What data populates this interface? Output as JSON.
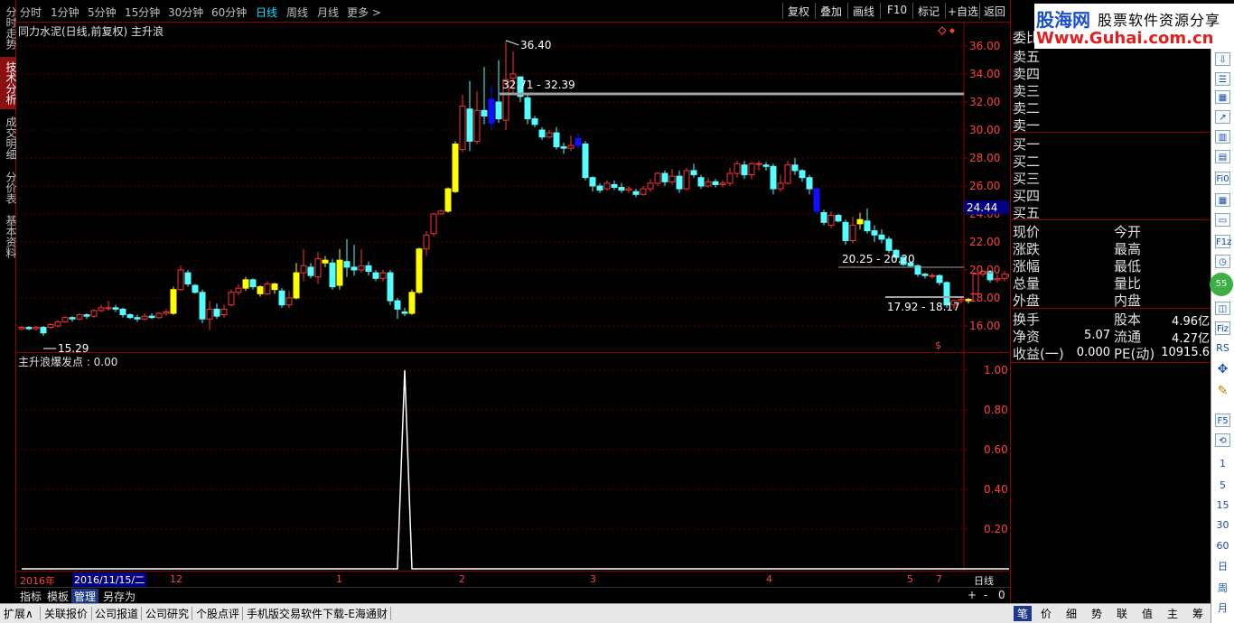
{
  "toolbar": {
    "periods": [
      "分时",
      "1分钟",
      "5分钟",
      "15分钟",
      "30分钟",
      "60分钟",
      "日线",
      "周线",
      "月线",
      "更多 >"
    ],
    "active_period": "日线",
    "buttons": [
      "复权",
      "叠加",
      "画线",
      "F10",
      "标记",
      "+自选",
      "返回"
    ]
  },
  "left_tabs": [
    "分时走势",
    "技术分析",
    "成交明细",
    "分价表",
    "基本资料"
  ],
  "main_chart": {
    "title": "同力水泥(日线,前复权) 主升浪",
    "price_axis": [
      "36.00",
      "34.00",
      "32.00",
      "30.00",
      "28.00",
      "26.00",
      "24.00",
      "22.00",
      "20.00",
      "18.00",
      "16.00"
    ],
    "current_price_tag": "24.44",
    "annotations": {
      "high": "36.40",
      "low": "15.29",
      "range1": "32.71 - 32.39",
      "range2": "20.25 - 20.20",
      "range3": "17.92 - 18.17"
    }
  },
  "sub_chart": {
    "title": "主升浪爆发点 : 0.00",
    "axis": [
      "1.00",
      "0.80",
      "0.60",
      "0.40",
      "0.20"
    ]
  },
  "chart_data": {
    "type": "candlestick",
    "ylim": [
      15,
      37
    ],
    "candles": [
      [
        15.8,
        15.9,
        15.7,
        16.0
      ],
      [
        15.9,
        15.8,
        15.7,
        16.0
      ],
      [
        15.8,
        15.9,
        15.7,
        16.0
      ],
      [
        15.9,
        15.5,
        15.29,
        16.0
      ],
      [
        15.9,
        16.1,
        15.8,
        16.2
      ],
      [
        16.0,
        16.3,
        15.9,
        16.4
      ],
      [
        16.3,
        16.6,
        16.2,
        16.7
      ],
      [
        16.6,
        16.5,
        16.3,
        16.7
      ],
      [
        16.5,
        16.8,
        16.4,
        16.9
      ],
      [
        16.8,
        16.7,
        16.5,
        16.9
      ],
      [
        16.7,
        17.1,
        16.6,
        17.2
      ],
      [
        17.1,
        17.3,
        17.0,
        17.5
      ],
      [
        17.3,
        17.3,
        17.1,
        17.8
      ],
      [
        17.3,
        17.2,
        17.0,
        17.5
      ],
      [
        17.2,
        16.8,
        16.6,
        17.3
      ],
      [
        16.8,
        16.6,
        16.5,
        16.9
      ],
      [
        16.6,
        16.5,
        16.3,
        16.8
      ],
      [
        16.5,
        16.7,
        16.4,
        16.9
      ],
      [
        16.7,
        16.6,
        16.5,
        16.9
      ],
      [
        16.6,
        16.9,
        16.5,
        17.0
      ],
      [
        16.9,
        17.0,
        16.7,
        17.2
      ],
      [
        16.9,
        18.6,
        16.8,
        18.8
      ],
      [
        18.6,
        20.0,
        18.5,
        20.3
      ],
      [
        19.8,
        19.0,
        18.8,
        20.0
      ],
      [
        18.9,
        18.4,
        18.3,
        19.0
      ],
      [
        18.4,
        16.5,
        16.2,
        18.6
      ],
      [
        16.5,
        17.2,
        15.7,
        17.8
      ],
      [
        17.2,
        16.7,
        16.5,
        17.6
      ],
      [
        16.8,
        17.2,
        16.6,
        17.5
      ],
      [
        17.5,
        18.4,
        17.4,
        18.6
      ],
      [
        18.4,
        18.7,
        18.2,
        19.0
      ],
      [
        18.7,
        19.3,
        18.5,
        19.5
      ],
      [
        19.3,
        18.8,
        18.6,
        19.4
      ],
      [
        18.8,
        18.3,
        18.1,
        18.9
      ],
      [
        18.3,
        19.0,
        18.2,
        19.2
      ],
      [
        19.0,
        18.6,
        18.3,
        19.1
      ],
      [
        18.5,
        17.5,
        17.3,
        18.7
      ],
      [
        17.5,
        18.0,
        17.3,
        18.5
      ],
      [
        18.0,
        19.8,
        17.9,
        20.5
      ],
      [
        19.8,
        20.3,
        19.2,
        21.5
      ],
      [
        20.2,
        19.6,
        19.4,
        20.5
      ],
      [
        19.5,
        20.8,
        19.0,
        21.3
      ],
      [
        20.7,
        20.5,
        20.2,
        21.0
      ],
      [
        20.5,
        18.8,
        18.6,
        20.8
      ],
      [
        18.9,
        20.7,
        18.6,
        21.5
      ],
      [
        20.6,
        20.2,
        19.5,
        22.2
      ],
      [
        20.2,
        20.0,
        19.6,
        21.8
      ],
      [
        20.0,
        20.3,
        19.8,
        21.5
      ],
      [
        20.3,
        19.9,
        19.6,
        20.6
      ],
      [
        19.8,
        19.4,
        19.2,
        20.0
      ],
      [
        19.4,
        19.8,
        19.2,
        20.0
      ],
      [
        19.8,
        17.8,
        17.5,
        20.0
      ],
      [
        17.8,
        17.2,
        16.5,
        18.0
      ],
      [
        17.0,
        16.9,
        16.7,
        17.3
      ],
      [
        16.9,
        18.4,
        16.8,
        18.6
      ],
      [
        18.4,
        21.5,
        18.3,
        21.6
      ],
      [
        21.5,
        22.5,
        21.0,
        22.8
      ],
      [
        22.6,
        24.0,
        22.4,
        24.1
      ],
      [
        24.0,
        24.2,
        24.0,
        24.3
      ],
      [
        24.2,
        25.8,
        24.1,
        25.9
      ],
      [
        25.6,
        29.0,
        25.5,
        29.2
      ],
      [
        28.6,
        31.7,
        28.4,
        32.5
      ],
      [
        31.5,
        29.2,
        28.5,
        33.5
      ],
      [
        29.2,
        31.4,
        29.0,
        32.8
      ],
      [
        31.4,
        31.0,
        30.4,
        34.5
      ],
      [
        30.5,
        32.2,
        30.0,
        33.2
      ],
      [
        32.0,
        30.8,
        30.5,
        35.0
      ],
      [
        30.7,
        33.6,
        30.0,
        36.4
      ],
      [
        33.7,
        34.0,
        32.6,
        35.6
      ],
      [
        33.8,
        32.4,
        32.0,
        33.8
      ],
      [
        32.3,
        30.8,
        30.4,
        32.6
      ],
      [
        30.8,
        30.4,
        30.2,
        31.0
      ],
      [
        30.0,
        29.5,
        29.3,
        30.2
      ],
      [
        29.5,
        29.8,
        29.4,
        30.0
      ],
      [
        29.8,
        28.8,
        28.6,
        30.2
      ],
      [
        28.8,
        28.7,
        28.3,
        29.1
      ],
      [
        28.7,
        28.9,
        28.5,
        29.6
      ],
      [
        28.9,
        29.4,
        28.7,
        29.8
      ],
      [
        29.0,
        26.6,
        26.4,
        29.2
      ],
      [
        26.6,
        26.0,
        25.6,
        26.7
      ],
      [
        26.0,
        25.7,
        25.5,
        26.2
      ],
      [
        25.8,
        26.2,
        25.7,
        26.4
      ],
      [
        26.1,
        25.9,
        25.7,
        26.4
      ],
      [
        25.9,
        25.7,
        25.5,
        26.2
      ],
      [
        25.7,
        25.8,
        25.5,
        26.0
      ],
      [
        25.6,
        25.4,
        25.2,
        25.8
      ],
      [
        25.4,
        25.8,
        25.3,
        26.0
      ],
      [
        25.8,
        26.2,
        25.6,
        26.5
      ],
      [
        26.2,
        26.9,
        26.0,
        27.0
      ],
      [
        26.9,
        26.3,
        26.0,
        27.1
      ],
      [
        26.3,
        26.7,
        26.1,
        27.2
      ],
      [
        26.7,
        25.8,
        25.5,
        27.1
      ],
      [
        25.8,
        27.1,
        25.7,
        27.3
      ],
      [
        27.1,
        26.8,
        26.6,
        27.6
      ],
      [
        26.6,
        26.0,
        25.8,
        26.8
      ],
      [
        26.0,
        26.3,
        25.9,
        26.6
      ],
      [
        26.3,
        26.1,
        25.9,
        26.5
      ],
      [
        26.1,
        26.2,
        25.9,
        26.4
      ],
      [
        26.2,
        26.9,
        26.0,
        27.3
      ],
      [
        26.9,
        27.6,
        26.6,
        27.8
      ],
      [
        27.5,
        26.8,
        26.5,
        27.8
      ],
      [
        26.8,
        27.6,
        26.5,
        27.7
      ],
      [
        27.6,
        27.6,
        27.1,
        27.8
      ],
      [
        27.5,
        27.4,
        27.1,
        27.7
      ],
      [
        27.4,
        25.8,
        25.4,
        27.6
      ],
      [
        25.8,
        26.2,
        25.6,
        26.8
      ],
      [
        26.2,
        27.5,
        26.1,
        27.8
      ],
      [
        27.5,
        27.1,
        26.8,
        28.0
      ],
      [
        27.1,
        26.6,
        26.3,
        27.2
      ],
      [
        26.6,
        25.8,
        25.4,
        26.8
      ],
      [
        25.8,
        24.2,
        24.0,
        25.9
      ],
      [
        24.1,
        23.4,
        23.2,
        24.3
      ],
      [
        23.2,
        23.9,
        23.0,
        24.2
      ],
      [
        23.9,
        23.5,
        23.4,
        24.0
      ],
      [
        23.4,
        22.1,
        21.8,
        23.6
      ],
      [
        22.1,
        23.2,
        21.9,
        23.8
      ],
      [
        23.3,
        23.6,
        22.9,
        24.1
      ],
      [
        23.5,
        22.8,
        22.6,
        24.4
      ],
      [
        22.8,
        22.5,
        22.0,
        23.2
      ],
      [
        22.5,
        22.2,
        21.9,
        22.9
      ],
      [
        22.2,
        21.4,
        21.2,
        22.4
      ],
      [
        21.4,
        20.9,
        20.6,
        21.5
      ],
      [
        20.9,
        20.4,
        20.3,
        21.0
      ],
      [
        20.5,
        20.3,
        20.2,
        20.6
      ],
      [
        20.3,
        19.7,
        19.5,
        20.4
      ],
      [
        19.7,
        19.6,
        19.4,
        19.8
      ],
      [
        19.6,
        19.6,
        19.4,
        19.8
      ],
      [
        19.6,
        19.1,
        18.9,
        19.7
      ],
      [
        19.1,
        17.5,
        17.3,
        19.2
      ],
      [
        17.5,
        17.8,
        17.2,
        17.9
      ],
      [
        17.8,
        17.9,
        17.6,
        18.1
      ],
      [
        17.8,
        17.9,
        17.6,
        18.0
      ],
      [
        18.3,
        19.7,
        18.2,
        19.8
      ],
      [
        19.7,
        19.9,
        19.5,
        20.0
      ],
      [
        19.9,
        19.3,
        19.1,
        20.0
      ],
      [
        19.3,
        19.4,
        19.1,
        19.7
      ],
      [
        19.4,
        19.7,
        19.2,
        19.9
      ],
      [
        19.7,
        19.5,
        19.3,
        19.8
      ],
      [
        19.5,
        19.6,
        19.2,
        19.8
      ],
      [
        19.6,
        19.3,
        19.2,
        19.7
      ],
      [
        19.3,
        19.4,
        19.2,
        19.6
      ]
    ],
    "signal": {
      "index": 53,
      "value": 1.0
    }
  },
  "date_axis": {
    "labels": [
      "2016年",
      "2016/11/15/二",
      "12",
      "1",
      "2",
      "3",
      "4",
      "5",
      "7"
    ],
    "period_label": "日线"
  },
  "bottom_tabs": [
    "指标",
    "模板",
    "管理",
    "另存为"
  ],
  "active_bottom_tab": "管理",
  "status_bar": [
    "扩展∧",
    "关联报价",
    "公司报道",
    "公司研究",
    "个股点评",
    "手机版交易软件下载-E海通财"
  ],
  "scroll_controls": [
    "+",
    "-",
    "0"
  ],
  "right_panel": {
    "logo_brand": "股海网",
    "logo_slogan": "股票软件资源分享",
    "logo_url": "Www.Guhai.com.cn",
    "orderbook_sell": [
      "委比",
      "卖五",
      "卖四",
      "卖三",
      "卖二",
      "卖一"
    ],
    "orderbook_buy": [
      "买一",
      "买二",
      "买三",
      "买四",
      "买五"
    ],
    "quote_left": [
      "现价",
      "涨跌",
      "涨幅",
      "总量",
      "外盘"
    ],
    "quote_right": [
      "今开",
      "最高",
      "最低",
      "量比",
      "内盘"
    ],
    "fund_labels": [
      "换手",
      "净资",
      "收益(一)"
    ],
    "fund_values": [
      "",
      "5.07",
      "0.000"
    ],
    "fund_labels2": [
      "股本",
      "流通",
      "PE(动)"
    ],
    "fund_values2": [
      "4.96亿",
      "4.27亿",
      "10915.6"
    ],
    "bottom_tabs": [
      "笔",
      "价",
      "细",
      "势",
      "联",
      "值",
      "主",
      "筹"
    ]
  },
  "icon_strip": {
    "labels": [
      "Fi0",
      "F1z",
      "Fiz",
      "F5",
      "1",
      "5",
      "15",
      "30",
      "60",
      "日",
      "周",
      "月"
    ]
  }
}
